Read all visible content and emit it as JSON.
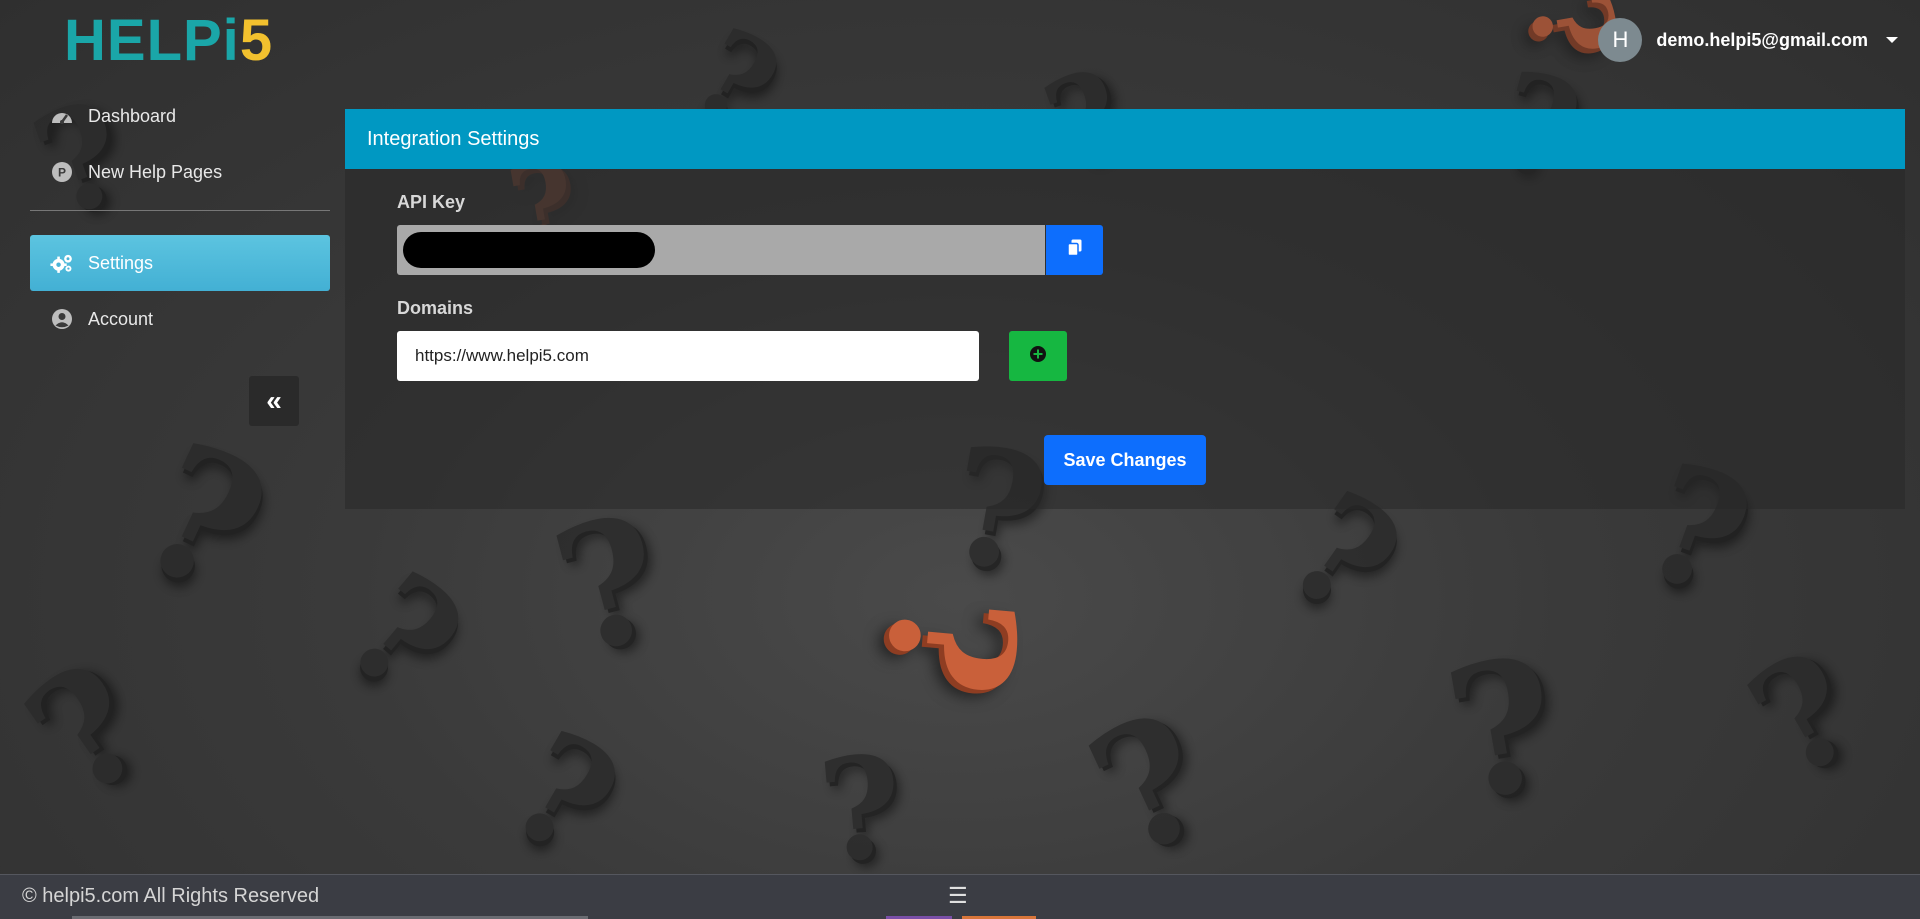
{
  "brand": {
    "logo_part1": "HELPi",
    "logo_part2": "5"
  },
  "user": {
    "avatar_initial": "H",
    "email": "demo.helpi5@gmail.com"
  },
  "sidebar": {
    "items": [
      {
        "label": "Dashboard",
        "icon": "dashboard-gauge-icon"
      },
      {
        "label": "New Help Pages",
        "icon": "p-circle-icon"
      },
      {
        "label": "Settings",
        "icon": "gears-icon",
        "active": true
      },
      {
        "label": "Account",
        "icon": "user-circle-icon"
      }
    ],
    "collapse_icon": "double-chevron-left-icon"
  },
  "panel": {
    "title": "Integration Settings",
    "api_key_label": "API Key",
    "domains_label": "Domains",
    "domain_value": "https://www.helpi5.com",
    "save_label": "Save Changes"
  },
  "footer": {
    "copyright": "© helpi5.com All Rights Reserved"
  },
  "colors": {
    "header_blue": "#0098c2",
    "active_nav": "#43b0d4",
    "primary_button": "#0d6efd",
    "add_button": "#16b741"
  }
}
